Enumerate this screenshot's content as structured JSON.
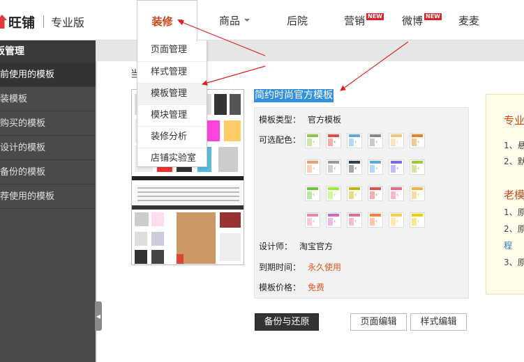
{
  "brand": {
    "name": "旺铺",
    "edition": "专业版"
  },
  "nav": {
    "decor": "装修",
    "goods": "商品",
    "backyard": "后院",
    "marketing": "营销",
    "weibo": "微博",
    "maimai": "麦麦",
    "new_badge": "NEW"
  },
  "dropdown": [
    "页面管理",
    "样式管理",
    "模板管理",
    "模块管理",
    "装修分析",
    "店铺实验室"
  ],
  "sidebar": {
    "title": "板管理",
    "items": [
      "前使用的模板",
      "装模板",
      "购买的模板",
      "设计的模板",
      "备份的模板",
      "荐使用的模板"
    ]
  },
  "content": {
    "crumb": "当",
    "template_title": "简约时尚官方模板",
    "type_label": "模板类型：",
    "type_value": "官方模板",
    "colors_label": "可选配色：",
    "designer_label": "设计师：",
    "designer_value": "淘宝官方",
    "expire_label": "到期时间：",
    "expire_value": "永久使用",
    "price_label": "模板价格：",
    "price_value": "免费",
    "swatches": [
      [
        "#8dc63f",
        "#e74c3c",
        "#5aa9e6",
        "#888888",
        "#f0c27b",
        "#e67e22"
      ],
      [
        "#f39c6b",
        "#999999",
        "#2c3e50",
        "#5aa9e6",
        "#7b68ee",
        "#9acd32"
      ],
      [
        "#66cc33",
        "#99ee33",
        "#c8b400",
        "#d9534f",
        "#ee6688",
        "#f5b041"
      ],
      [
        "#ee88aa",
        "#cc66cc",
        "#e0708a",
        "#ff7f3f",
        "#ffcc44",
        "#e8d000"
      ]
    ]
  },
  "buttons": {
    "backup": "备份与还原",
    "page_edit": "页面编辑",
    "style_edit": "样式编辑"
  },
  "tips": {
    "h1": "专业",
    "l1": "1、悬",
    "l2": "2、默",
    "h2": "老模",
    "l3": "1、原",
    "l4": "2、原",
    "link": "程",
    "l5": "3、原"
  }
}
